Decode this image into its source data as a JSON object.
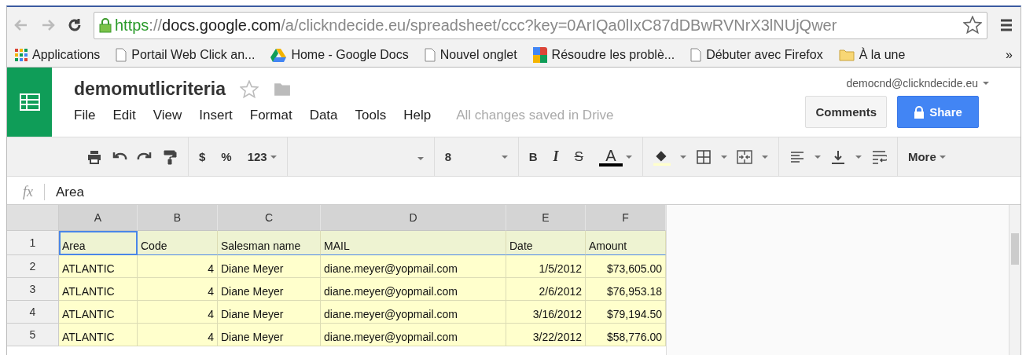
{
  "browser": {
    "url": {
      "scheme": "https",
      "separator": "://",
      "host": "docs.google.com",
      "path": "/a/clickndecide.eu/spreadsheet/ccc?key=0ArIQa0lIxC87dDBwRVNrX3lNUjQwer"
    },
    "bookmarks": [
      {
        "kind": "apps",
        "label": "Applications"
      },
      {
        "kind": "page",
        "label": "Portail Web Click an..."
      },
      {
        "kind": "drive",
        "label": "Home - Google Docs"
      },
      {
        "kind": "page",
        "label": "Nouvel onglet"
      },
      {
        "kind": "google",
        "label": "Résoudre les problè..."
      },
      {
        "kind": "page",
        "label": "Débuter avec Firefox"
      },
      {
        "kind": "folder",
        "label": "À la une"
      }
    ],
    "more": "»"
  },
  "doc": {
    "title": "demomutlicriteria",
    "menu": [
      "File",
      "Edit",
      "View",
      "Insert",
      "Format",
      "Data",
      "Tools",
      "Help"
    ],
    "save_status": "All changes saved in Drive",
    "account": "democnd@clickndecide.eu",
    "comments": "Comments",
    "share": "Share"
  },
  "toolbar": {
    "currency": "$",
    "percent": "%",
    "number_format": "123",
    "font_size": "8",
    "bold": "B",
    "italic": "I",
    "strike": "S",
    "text_color": "A",
    "more": "More"
  },
  "formula_bar": {
    "label": "fx",
    "value": "Area"
  },
  "sheet": {
    "columns": [
      "A",
      "B",
      "C",
      "D",
      "E",
      "F"
    ],
    "rows": [
      {
        "number": "1",
        "cells": [
          "Area",
          "Code",
          "Salesman name",
          "MAIL",
          "Date",
          "Amount"
        ]
      },
      {
        "number": "2",
        "cells": [
          "ATLANTIC",
          "4",
          "Diane Meyer",
          "diane.meyer@yopmail.com",
          "1/5/2012",
          "$73,605.00"
        ]
      },
      {
        "number": "3",
        "cells": [
          "ATLANTIC",
          "4",
          "Diane Meyer",
          "diane.meyer@yopmail.com",
          "2/6/2012",
          "$76,953.18"
        ]
      },
      {
        "number": "4",
        "cells": [
          "ATLANTIC",
          "4",
          "Diane Meyer",
          "diane.meyer@yopmail.com",
          "3/16/2012",
          "$79,194.50"
        ]
      },
      {
        "number": "5",
        "cells": [
          "ATLANTIC",
          "4",
          "Diane Meyer",
          "diane.meyer@yopmail.com",
          "3/22/2012",
          "$58,776.00"
        ]
      }
    ]
  }
}
